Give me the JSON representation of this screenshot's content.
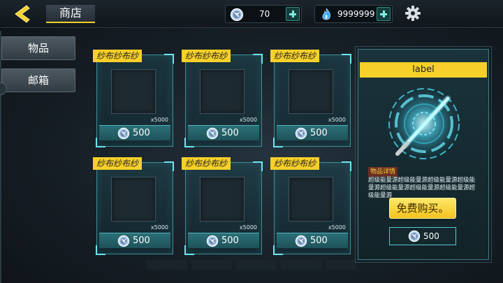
{
  "header": {
    "title": "商店",
    "currency_a": {
      "value": "70",
      "icon": "silver-coin-icon"
    },
    "currency_b": {
      "value": "9999999",
      "icon": "blue-flame-icon"
    }
  },
  "sidebar": {
    "items": [
      {
        "label": "物品"
      },
      {
        "label": "邮箱"
      }
    ]
  },
  "items": [
    {
      "name": "纱布纱布纱",
      "qty": "x5000",
      "price": "500"
    },
    {
      "name": "纱布纱布纱",
      "qty": "x5000",
      "price": "500"
    },
    {
      "name": "纱布纱布纱",
      "qty": "x5000",
      "price": "500"
    },
    {
      "name": "纱布纱布纱",
      "qty": "x5000",
      "price": "500"
    },
    {
      "name": "纱布纱布纱",
      "qty": "x5000",
      "price": "500"
    },
    {
      "name": "纱布纱布纱",
      "qty": "x5000",
      "price": "500"
    }
  ],
  "detail": {
    "label": "label",
    "desc_title": "物品详情",
    "desc_text": "超级能量源超级能量源超级能量源超级能量源超级能量源超级能量源超级能量源超级能量源",
    "buy_label": "免费购买。",
    "price": "500"
  },
  "colors": {
    "accent_yellow": "#f7d02a",
    "accent_cyan": "#6fe6ef",
    "panel_bg": "#1a333b"
  }
}
